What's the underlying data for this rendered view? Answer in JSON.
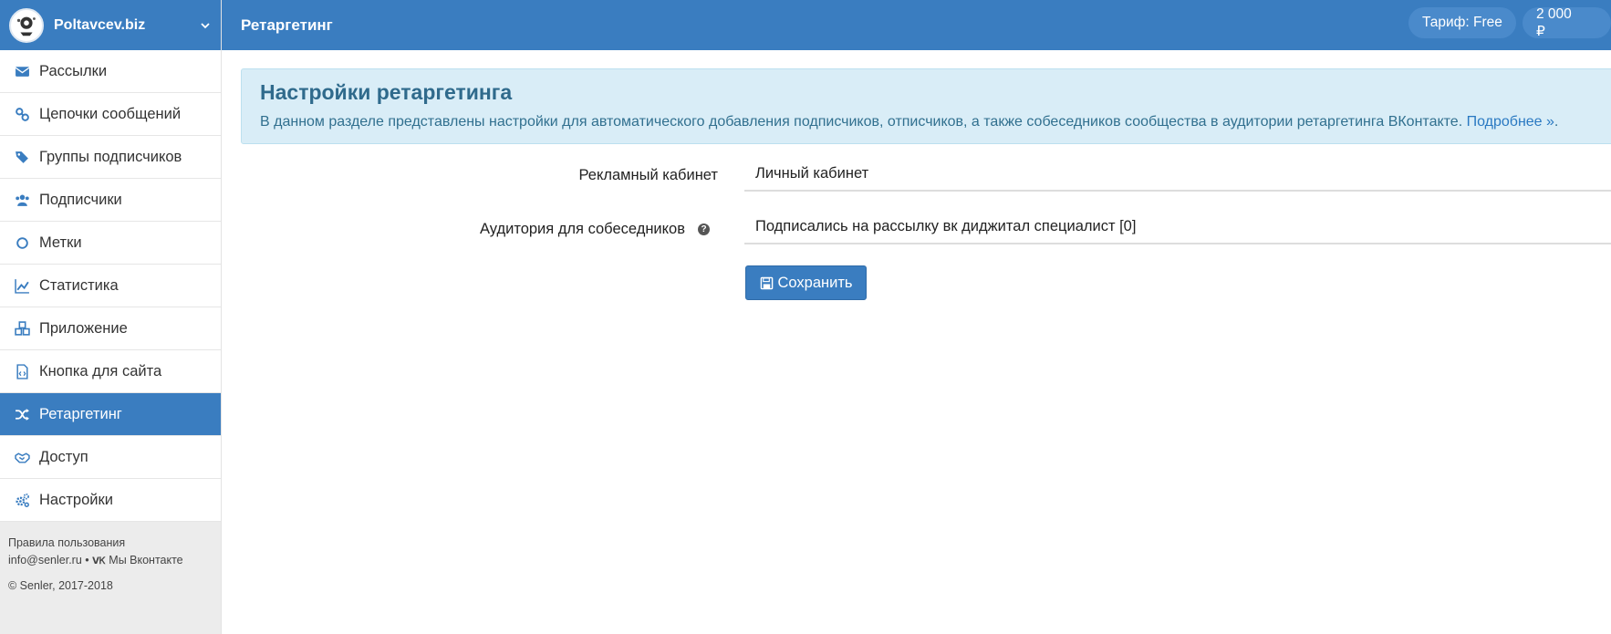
{
  "brand": {
    "name": "Poltavcev.biz"
  },
  "nav": {
    "items": [
      {
        "label": "Рассылки",
        "icon": "envelope-icon",
        "active": false
      },
      {
        "label": "Цепочки сообщений",
        "icon": "chain-link-icon",
        "active": false
      },
      {
        "label": "Группы подписчиков",
        "icon": "tags-icon",
        "active": false
      },
      {
        "label": "Подписчики",
        "icon": "users-icon",
        "active": false
      },
      {
        "label": "Метки",
        "icon": "circle-icon",
        "active": false
      },
      {
        "label": "Статистика",
        "icon": "line-chart-icon",
        "active": false
      },
      {
        "label": "Приложение",
        "icon": "cubes-icon",
        "active": false
      },
      {
        "label": "Кнопка для сайта",
        "icon": "code-file-icon",
        "active": false
      },
      {
        "label": "Ретаргетинг",
        "icon": "random-shuffle-icon",
        "active": true
      },
      {
        "label": "Доступ",
        "icon": "handshake-icon",
        "active": false
      },
      {
        "label": "Настройки",
        "icon": "gears-icon",
        "active": false
      }
    ]
  },
  "footer": {
    "terms": "Правила пользования",
    "email": "info@senler.ru",
    "separator": "•",
    "vk_link": "Мы Вконтакте",
    "copyright": "© Senler, 2017-2018"
  },
  "topbar": {
    "title": "Ретаргетинг",
    "tariff": "Тариф: Free",
    "balance": "2 000 ₽"
  },
  "info": {
    "heading": "Настройки ретаргетинга",
    "text": "В данном разделе представлены настройки для автоматического добавления подписчиков, отписчиков, а также собеседников сообщества в аудитории ретаргетинга ВКонтакте.",
    "more_link": "Подробнее »",
    "end": "."
  },
  "form": {
    "ad_cabinet_label": "Рекламный кабинет",
    "ad_cabinet_value": "Личный кабинет",
    "audience_label": "Аудитория для собеседников",
    "audience_value": "Подписались на рассылку вк диджитал специалист [0]",
    "help_glyph": "?",
    "save_label": "Сохранить"
  },
  "colors": {
    "primary": "#3a7dc0",
    "info_bg": "#d9edf7",
    "info_text": "#31708f",
    "sidebar_bg": "#ececec"
  }
}
